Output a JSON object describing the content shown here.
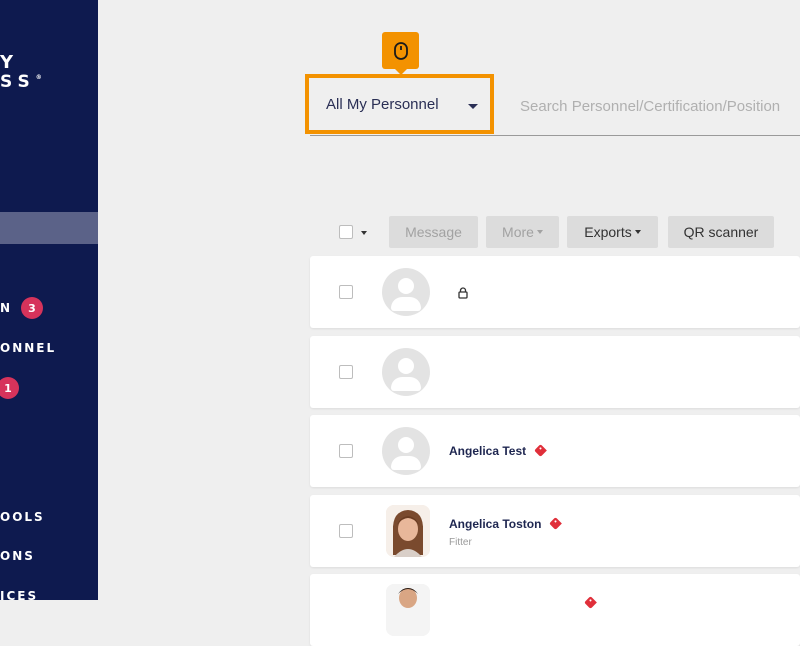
{
  "sidebar": {
    "logo_line1": "Y",
    "logo_line2": "SS",
    "logo_mark": "®",
    "items": [
      {
        "label": "N",
        "badge": "3"
      },
      {
        "label": "ONNEL"
      },
      {
        "label": "",
        "badge": "1"
      },
      {
        "label": "OOLS"
      },
      {
        "label": "ONS"
      },
      {
        "label": "ICES"
      }
    ]
  },
  "tooltip": {
    "icon": "mouse-icon",
    "color": "#f39200"
  },
  "filter": {
    "selected": "All My Personnel"
  },
  "search": {
    "placeholder": "Search Personnel/Certification/Position"
  },
  "toolbar": {
    "message_label": "Message",
    "more_label": "More",
    "exports_label": "Exports",
    "qr_label": "QR scanner"
  },
  "rows": [
    {
      "name": "",
      "subtitle": "",
      "locked": true
    },
    {
      "name": "",
      "subtitle": ""
    },
    {
      "name": "Angelica Test",
      "subtitle": "",
      "tag": true
    },
    {
      "name": "Angelica Toston",
      "subtitle": "Fitter",
      "tag": true
    },
    {
      "name": "",
      "subtitle": ""
    }
  ],
  "colors": {
    "sidebar_bg": "#0e1a4f",
    "accent_orange": "#f39200",
    "badge_red": "#d6335b",
    "tag_red": "#e02f3a"
  }
}
